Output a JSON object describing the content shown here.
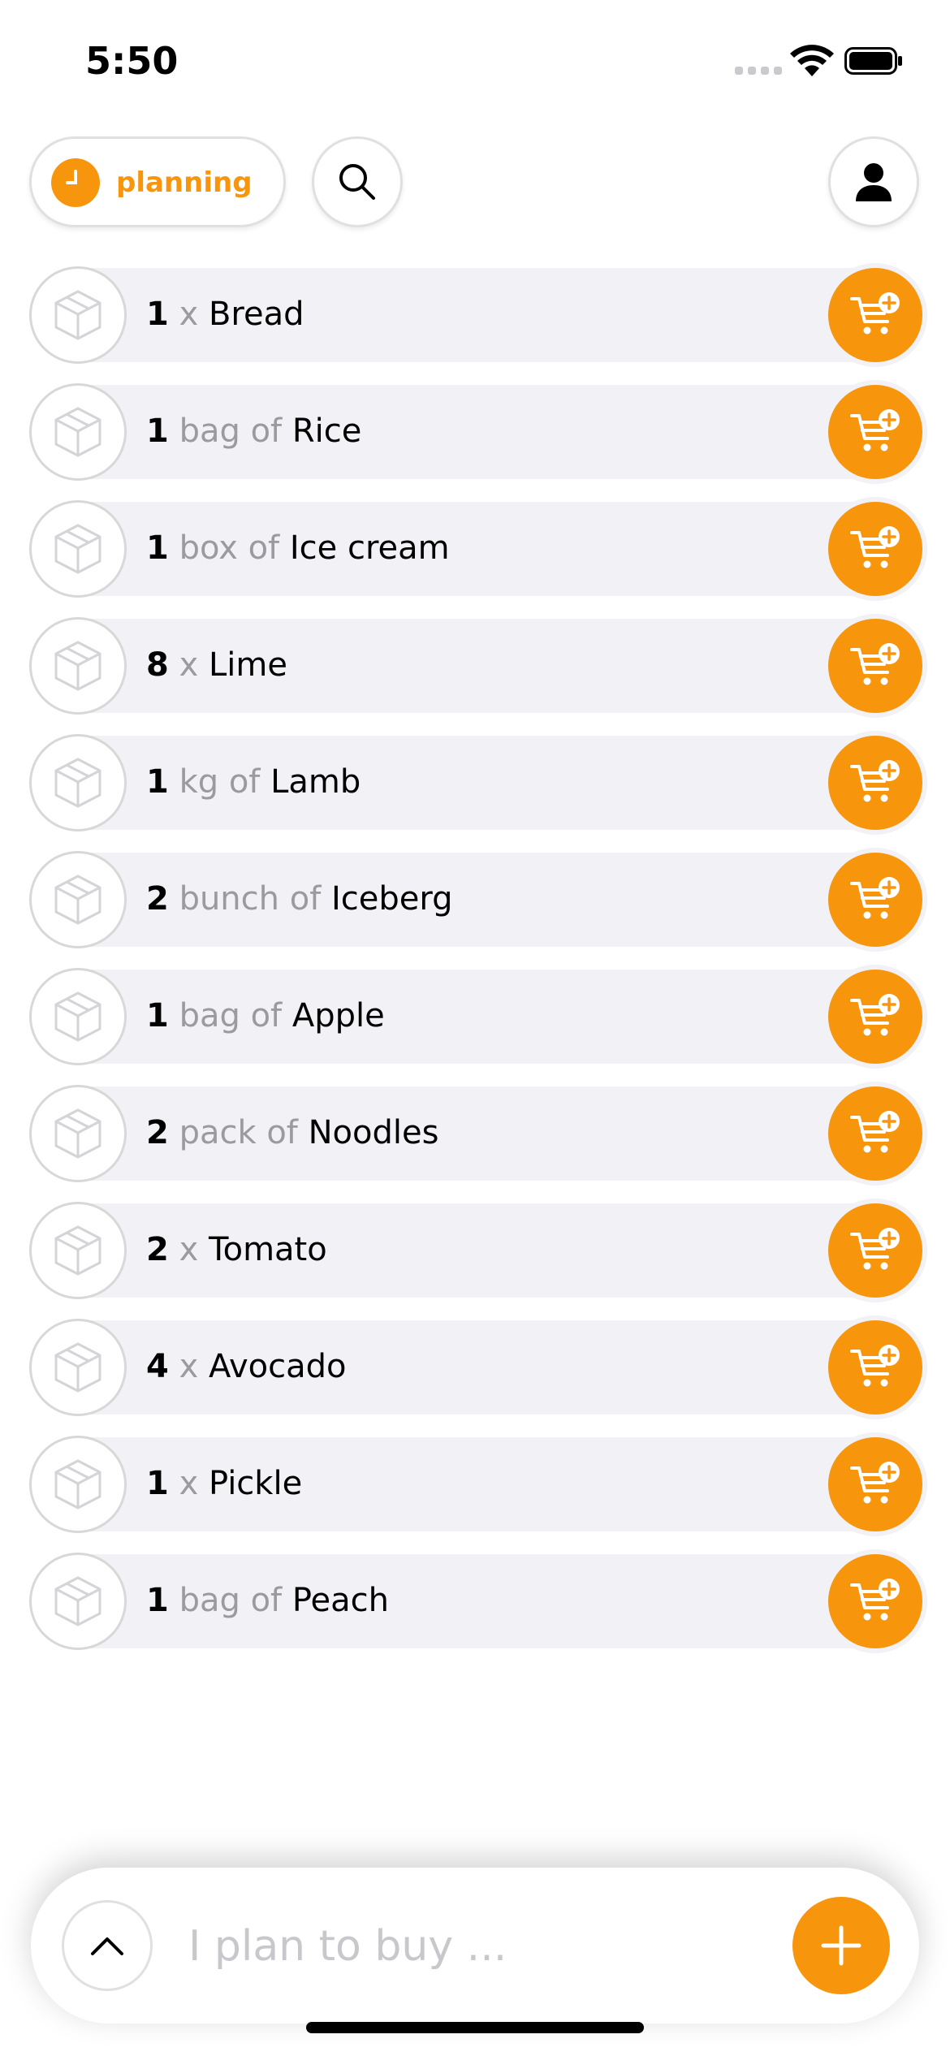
{
  "status_bar": {
    "time": "5:50"
  },
  "header": {
    "filter_label": "planning",
    "icons": {
      "filter": "clock-icon",
      "search": "search-icon",
      "profile": "person-icon"
    }
  },
  "items": [
    {
      "qty": "1",
      "unit": "x",
      "name": "Bread"
    },
    {
      "qty": "1",
      "unit": "bag of",
      "name": "Rice"
    },
    {
      "qty": "1",
      "unit": "box of",
      "name": "Ice cream"
    },
    {
      "qty": "8",
      "unit": "x",
      "name": "Lime"
    },
    {
      "qty": "1",
      "unit": "kg of",
      "name": "Lamb"
    },
    {
      "qty": "2",
      "unit": "bunch of",
      "name": "Iceberg"
    },
    {
      "qty": "1",
      "unit": "bag of",
      "name": "Apple"
    },
    {
      "qty": "2",
      "unit": "pack of",
      "name": "Noodles"
    },
    {
      "qty": "2",
      "unit": "x",
      "name": "Tomato"
    },
    {
      "qty": "4",
      "unit": "x",
      "name": "Avocado"
    },
    {
      "qty": "1",
      "unit": "x",
      "name": "Pickle"
    },
    {
      "qty": "1",
      "unit": "bag of",
      "name": "Peach"
    }
  ],
  "bottom_bar": {
    "placeholder": "I plan to buy ...",
    "value": ""
  },
  "colors": {
    "accent": "#f7950c",
    "row_bg": "#f1f1f6",
    "unit_text": "#9a9a9f"
  }
}
